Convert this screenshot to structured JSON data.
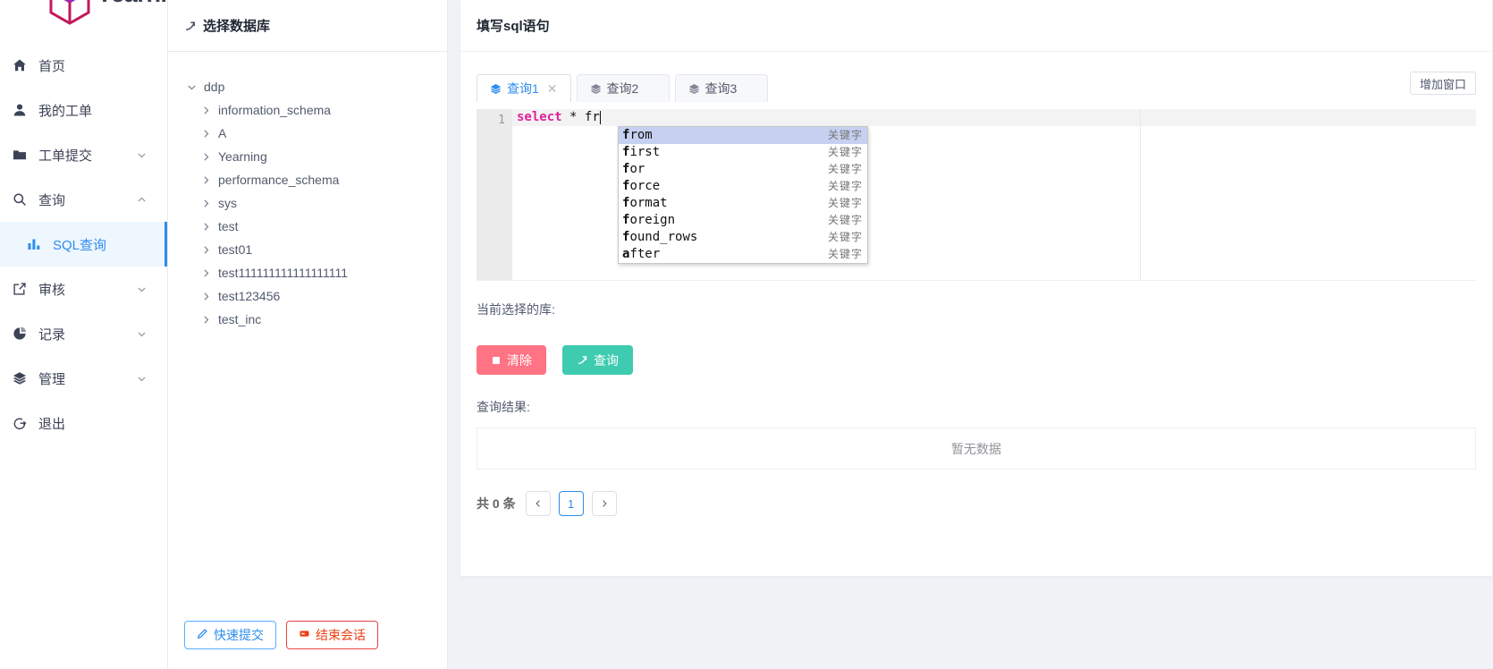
{
  "brand": {
    "name": "Yearning",
    "logo_icon": "cube-logo-icon",
    "color": "#c2185b"
  },
  "sidebar": {
    "items": [
      {
        "label": "首页",
        "icon": "home-icon",
        "has_arrow": false,
        "arrow": ""
      },
      {
        "label": "我的工单",
        "icon": "user-icon",
        "has_arrow": false,
        "arrow": ""
      },
      {
        "label": "工单提交",
        "icon": "folder-icon",
        "has_arrow": true,
        "arrow": "chevron-down-icon"
      },
      {
        "label": "查询",
        "icon": "search-icon",
        "has_arrow": true,
        "arrow": "chevron-up-icon"
      },
      {
        "label": "审核",
        "icon": "external-link-icon",
        "has_arrow": true,
        "arrow": "chevron-down-icon"
      },
      {
        "label": "记录",
        "icon": "pie-chart-icon",
        "has_arrow": true,
        "arrow": "chevron-down-icon"
      },
      {
        "label": "管理",
        "icon": "layers-icon",
        "has_arrow": true,
        "arrow": "chevron-down-icon"
      },
      {
        "label": "退出",
        "icon": "logout-icon",
        "has_arrow": false,
        "arrow": ""
      }
    ],
    "active_sub": {
      "label": "SQL查询",
      "icon": "bar-chart-icon",
      "accent": "#2d8cf0"
    }
  },
  "tree_panel": {
    "title": "选择数据库",
    "title_icon": "arrow-up-right-icon",
    "root": {
      "label": "ddp",
      "toggle": "chevron-down-icon",
      "expanded": true
    },
    "children": [
      {
        "label": "information_schema",
        "toggle": "chevron-right-icon"
      },
      {
        "label": "A",
        "toggle": "chevron-right-icon"
      },
      {
        "label": "Yearning",
        "toggle": "chevron-right-icon"
      },
      {
        "label": "performance_schema",
        "toggle": "chevron-right-icon"
      },
      {
        "label": "sys",
        "toggle": "chevron-right-icon"
      },
      {
        "label": "test",
        "toggle": "chevron-right-icon"
      },
      {
        "label": "test01",
        "toggle": "chevron-right-icon"
      },
      {
        "label": "test111111111111111111",
        "toggle": "chevron-right-icon"
      },
      {
        "label": "test123456",
        "toggle": "chevron-right-icon"
      },
      {
        "label": "test_inc",
        "toggle": "chevron-right-icon"
      }
    ],
    "footer": {
      "quick_submit": {
        "label": "快速提交",
        "icon": "pencil-icon",
        "color": "#2d8cf0"
      },
      "end_session": {
        "label": "结束会话",
        "icon": "power-icon",
        "color": "#ed4014"
      }
    }
  },
  "main": {
    "card_title": "填写sql语句",
    "add_window_label": "增加窗口",
    "tabs": [
      {
        "label": "查询1",
        "icon": "layers-icon",
        "active": true,
        "closable": true,
        "close_icon": "close-icon"
      },
      {
        "label": "查询2",
        "icon": "layers-icon",
        "active": false,
        "closable": false,
        "close_icon": ""
      },
      {
        "label": "查询3",
        "icon": "layers-icon",
        "active": false,
        "closable": false,
        "close_icon": ""
      }
    ],
    "editor": {
      "line_number": "1",
      "code_keyword": "select",
      "code_star": "*",
      "code_typed": "fr",
      "full_text": "select * fr"
    },
    "autocomplete": {
      "meta_label": "关键字",
      "items": [
        {
          "match": "f",
          "rest": "rom",
          "text": "from",
          "meta": "关键字",
          "selected": true
        },
        {
          "match": "f",
          "rest": "irst",
          "text": "first",
          "meta": "关键字",
          "selected": false
        },
        {
          "match": "f",
          "rest": "or",
          "text": "for",
          "meta": "关键字",
          "selected": false
        },
        {
          "match": "f",
          "rest": "orce",
          "text": "force",
          "meta": "关键字",
          "selected": false
        },
        {
          "match": "f",
          "rest": "ormat",
          "text": "format",
          "meta": "关键字",
          "selected": false
        },
        {
          "match": "f",
          "rest": "oreign",
          "text": "foreign",
          "meta": "关键字",
          "selected": false
        },
        {
          "match": "f",
          "rest": "ound_rows",
          "text": "found_rows",
          "meta": "关键字",
          "selected": false
        },
        {
          "match": "a",
          "rest": "fter",
          "text": "after",
          "meta": "关键字",
          "selected": false
        }
      ]
    },
    "current_db_label": "当前选择的库:",
    "current_db_value": "",
    "buttons": {
      "clear": {
        "label": "清除",
        "icon": "stop-square-icon",
        "color": "#ff7384"
      },
      "query": {
        "label": "查询",
        "icon": "arrow-up-right-icon",
        "color": "#3ecbb0"
      }
    },
    "result_label": "查询结果:",
    "empty_text": "暂无数据",
    "pagination": {
      "total_text": "共 0 条",
      "prev_icon": "chevron-left-icon",
      "next_icon": "chevron-right-icon",
      "current_page": "1"
    }
  }
}
